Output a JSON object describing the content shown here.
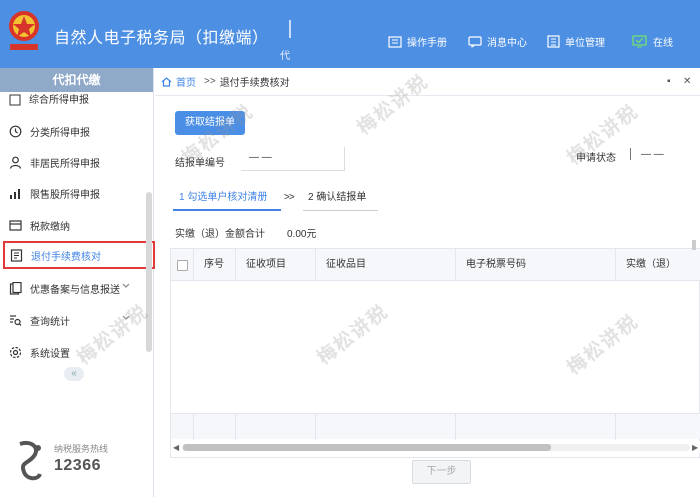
{
  "header": {
    "title": "自然人电子税务局（扣缴端）",
    "sub": "代",
    "items": [
      {
        "label": "操作手册",
        "icon": "manual-icon"
      },
      {
        "label": "消息中心",
        "icon": "message-icon"
      },
      {
        "label": "单位管理",
        "icon": "company-icon"
      },
      {
        "label": "在线",
        "icon": "online-monitor-icon"
      }
    ]
  },
  "sidebar": {
    "header": "代扣代缴",
    "items": [
      {
        "label": "综合所得申报",
        "icon": "report-icon"
      },
      {
        "label": "分类所得申报",
        "icon": "clock-icon"
      },
      {
        "label": "非居民所得申报",
        "icon": "user-icon"
      },
      {
        "label": "限售股所得申报",
        "icon": "bar-chart-icon"
      },
      {
        "label": "税款缴纳",
        "icon": "payment-icon"
      },
      {
        "label": "退付手续费核对",
        "icon": "document-icon"
      },
      {
        "label": "优惠备案与信息报送",
        "icon": "file-icon"
      },
      {
        "label": "查询统计",
        "icon": "search-list-icon"
      },
      {
        "label": "系统设置",
        "icon": "settings-icon"
      }
    ],
    "collapse": "«",
    "hotline_label": "纳税服务热线",
    "hotline_number": "12366"
  },
  "main": {
    "breadcrumb_home": "首页",
    "breadcrumb_sep": ">>",
    "breadcrumb_current": "退付手续费核对",
    "get_report_button": "获取结报单",
    "report_no_label": "结报单编号",
    "report_no_value": "— —",
    "status_label": "申请状态",
    "status_value": "— —",
    "step1": "1 勾选单户核对清册",
    "step_arrow": ">>",
    "step2": "2 确认结报单",
    "total_label": "实缴（退）金额合计",
    "total_value": "0.00元",
    "columns": [
      "序号",
      "征收项目",
      "征收品目",
      "电子税票号码",
      "实缴（退）"
    ],
    "next_button": "下一步"
  },
  "watermark": "梅松讲税",
  "colors": {
    "header_bg": "#4d8fe3",
    "accent": "#3f83e6",
    "active_border": "#e03a3a"
  }
}
